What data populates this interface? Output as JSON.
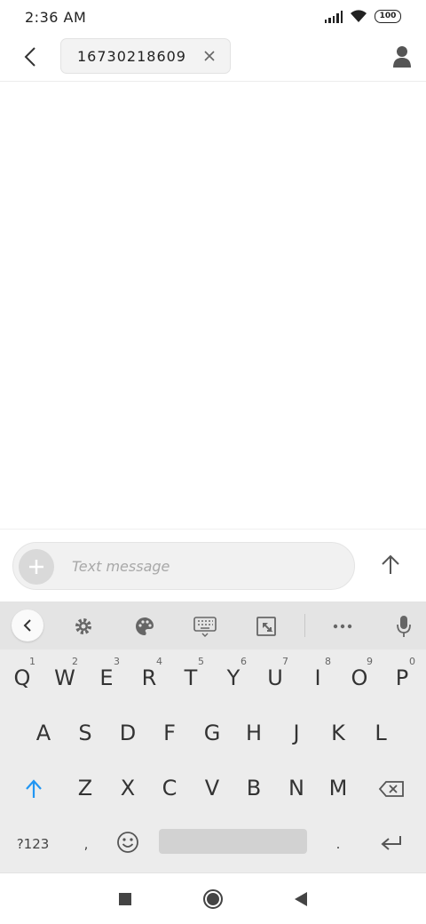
{
  "status_bar": {
    "time": "2:36 AM",
    "battery": "100",
    "icons": [
      "signal-icon",
      "wifi-icon",
      "battery-icon"
    ]
  },
  "header": {
    "recipient_number": "16730218609",
    "icons": [
      "back-arrow-icon",
      "close-icon",
      "contact-person-icon"
    ]
  },
  "compose": {
    "placeholder": "Text message",
    "icons": [
      "plus-icon",
      "send-arrow-up-icon"
    ]
  },
  "keyboard": {
    "toolbar_icons": [
      "chevron-left-icon",
      "gear-icon",
      "palette-icon",
      "keyboard-icon",
      "floating-keyboard-icon",
      "more-dots-icon",
      "microphone-icon"
    ],
    "row1": [
      {
        "key": "Q",
        "hint": "1"
      },
      {
        "key": "W",
        "hint": "2"
      },
      {
        "key": "E",
        "hint": "3"
      },
      {
        "key": "R",
        "hint": "4"
      },
      {
        "key": "T",
        "hint": "5"
      },
      {
        "key": "Y",
        "hint": "6"
      },
      {
        "key": "U",
        "hint": "7"
      },
      {
        "key": "I",
        "hint": "8"
      },
      {
        "key": "O",
        "hint": "9"
      },
      {
        "key": "P",
        "hint": "0"
      }
    ],
    "row2": [
      "A",
      "S",
      "D",
      "F",
      "G",
      "H",
      "J",
      "K",
      "L"
    ],
    "row3": [
      "Z",
      "X",
      "C",
      "V",
      "B",
      "N",
      "M"
    ],
    "row4": {
      "symbols_label": "?123",
      "comma": ",",
      "period": "."
    },
    "colors": {
      "shift_accent": "#2196f3",
      "background": "#ececec"
    }
  },
  "navigation_bar": {
    "icons": [
      "recents-square-icon",
      "home-circle-icon",
      "back-triangle-icon"
    ]
  }
}
